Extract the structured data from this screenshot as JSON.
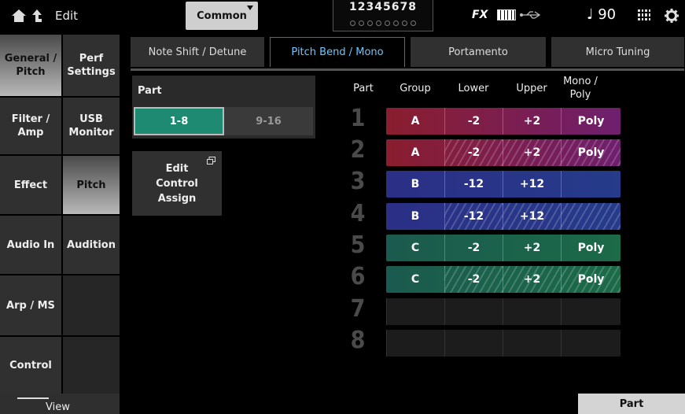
{
  "header": {
    "title": "Edit",
    "common_label": "Common",
    "part_numbers": "12345678",
    "fx_label": "FX",
    "tempo": "♩ 90"
  },
  "sidebar": {
    "left": [
      "General / Pitch",
      "Filter / Amp",
      "Effect",
      "Audio In",
      "Arp / MS",
      "Control"
    ],
    "right": [
      "Perf Settings",
      "USB Monitor",
      "Pitch",
      "Audition",
      "",
      ""
    ],
    "view_label": "View"
  },
  "tabs": [
    "Note Shift / Detune",
    "Pitch Bend / Mono",
    "Portamento",
    "Micro Tuning"
  ],
  "part_panel": {
    "label": "Part",
    "range_1": "1-8",
    "range_2": "9-16"
  },
  "edit_control_assign": "Edit Control Assign",
  "table": {
    "headers": {
      "part": "Part",
      "group": "Group",
      "lower": "Lower",
      "upper": "Upper",
      "mono_poly": "Mono / Poly"
    },
    "rows": [
      {
        "part": "1",
        "group": "A",
        "lower": "-2",
        "upper": "+2",
        "mono_poly": "Poly",
        "color": "#8a1d2e",
        "color2": "#6e1f6e",
        "hatched": false
      },
      {
        "part": "2",
        "group": "A",
        "lower": "-2",
        "upper": "+2",
        "mono_poly": "Poly",
        "color": "#8a1d2e",
        "color2": "#6e1f6e",
        "hatched": true
      },
      {
        "part": "3",
        "group": "B",
        "lower": "-12",
        "upper": "+12",
        "mono_poly": "",
        "color": "#2b2f86",
        "color2": "#263b8a",
        "hatched": false
      },
      {
        "part": "4",
        "group": "B",
        "lower": "-12",
        "upper": "+12",
        "mono_poly": "",
        "color": "#2b2f86",
        "color2": "#263b8a",
        "hatched": true
      },
      {
        "part": "5",
        "group": "C",
        "lower": "-2",
        "upper": "+2",
        "mono_poly": "Poly",
        "color": "#1b5a4e",
        "color2": "#1b6a48",
        "hatched": false
      },
      {
        "part": "6",
        "group": "C",
        "lower": "-2",
        "upper": "+2",
        "mono_poly": "Poly",
        "color": "#1b5a4e",
        "color2": "#1b6a48",
        "hatched": true
      },
      {
        "part": "7",
        "group": "",
        "lower": "",
        "upper": "",
        "mono_poly": "",
        "color": "",
        "color2": "",
        "hatched": false
      },
      {
        "part": "8",
        "group": "",
        "lower": "",
        "upper": "",
        "mono_poly": "",
        "color": "",
        "color2": "",
        "hatched": false
      }
    ]
  },
  "footer": {
    "part_button": "Part"
  },
  "colors": {
    "accent_tab": "#6ec6ff",
    "part_on": "#1d8a71"
  }
}
